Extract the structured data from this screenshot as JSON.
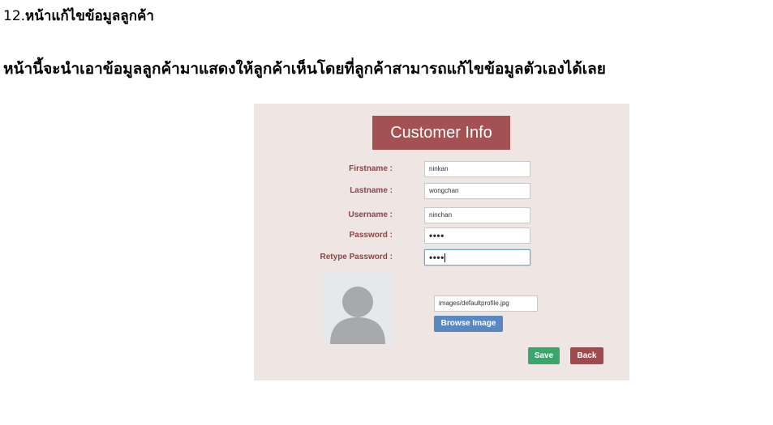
{
  "heading": {
    "number": "12.",
    "text": "หน้าแก้ไขข้อมูลลูกค้า"
  },
  "description": "หน้านี้จะนำเอาข้อมูลลูกค้ามาแสดงให้ลูกค้าเห็นโดยที่ลูกค้าสามารถแก้ไขข้อมูลตัวเองได้เลย",
  "form": {
    "title": "Customer Info",
    "fields": [
      {
        "label": "Firstname :",
        "value": "ninkan"
      },
      {
        "label": "Lastname :",
        "value": "wongchan"
      },
      {
        "label": "Username :",
        "value": "ninchan"
      },
      {
        "label": "Password :",
        "value": "••••"
      },
      {
        "label": "Retype Password :",
        "value": "••••"
      }
    ],
    "image_path": "images/defaultprofile.jpg",
    "browse_label": "Browse Image",
    "save_label": "Save",
    "back_label": "Back"
  },
  "colors": {
    "panel_bg": "#efe6e4",
    "title_bg": "#a35152",
    "label_color": "#8b4547",
    "browse_bg": "#5b87c0",
    "save_bg": "#3ca56b",
    "back_bg": "#a04a4d"
  },
  "icons": {
    "avatar": "default-profile-avatar-icon"
  }
}
